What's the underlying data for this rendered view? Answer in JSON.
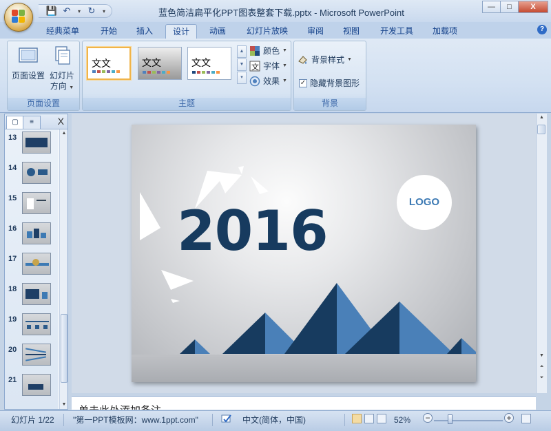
{
  "window": {
    "title": "蓝色简洁扁平化PPT图表整套下载.pptx - Microsoft PowerPoint",
    "controls": {
      "minimize": "—",
      "maximize": "□",
      "close": "X"
    }
  },
  "quick_access": {
    "save": "💾",
    "undo": "↶",
    "redo": "↻",
    "dropdown": "▾",
    "customize": "▾"
  },
  "tabs": [
    {
      "label": "经典菜单",
      "active": false
    },
    {
      "label": "开始",
      "active": false
    },
    {
      "label": "插入",
      "active": false
    },
    {
      "label": "设计",
      "active": true
    },
    {
      "label": "动画",
      "active": false
    },
    {
      "label": "幻灯片放映",
      "active": false
    },
    {
      "label": "审阅",
      "active": false
    },
    {
      "label": "视图",
      "active": false
    },
    {
      "label": "开发工具",
      "active": false
    },
    {
      "label": "加载项",
      "active": false
    }
  ],
  "help": "?",
  "ribbon": {
    "page_setup": {
      "label": "页面设置",
      "page_setup_button": "页面设置",
      "orientation_button_line1": "幻灯片",
      "orientation_button_line2": "方向"
    },
    "themes": {
      "label": "主题",
      "thumb_text": "文文",
      "colors": "颜色",
      "fonts": "字体",
      "effects": "效果"
    },
    "background": {
      "label": "背景",
      "styles": "背景样式",
      "hide_graphics": "隐藏背景图形",
      "hide_graphics_checked": true
    }
  },
  "slides_pane": {
    "close": "X",
    "slides": [
      {
        "num": "13"
      },
      {
        "num": "14"
      },
      {
        "num": "15"
      },
      {
        "num": "16"
      },
      {
        "num": "17"
      },
      {
        "num": "18"
      },
      {
        "num": "19"
      },
      {
        "num": "20"
      },
      {
        "num": "21"
      }
    ]
  },
  "slide": {
    "year": "2016",
    "logo": "LOGO",
    "colors": {
      "dark": "#173b5f",
      "light": "#4a80b8"
    }
  },
  "notes": {
    "placeholder": "单击此处添加备注"
  },
  "status": {
    "slide_counter": "幻灯片 1/22",
    "theme": "\"第一PPT模板网：www.1ppt.com\"",
    "language": "中文(简体，中国)",
    "zoom": "52%",
    "zoom_minus": "−",
    "zoom_plus": "+"
  }
}
